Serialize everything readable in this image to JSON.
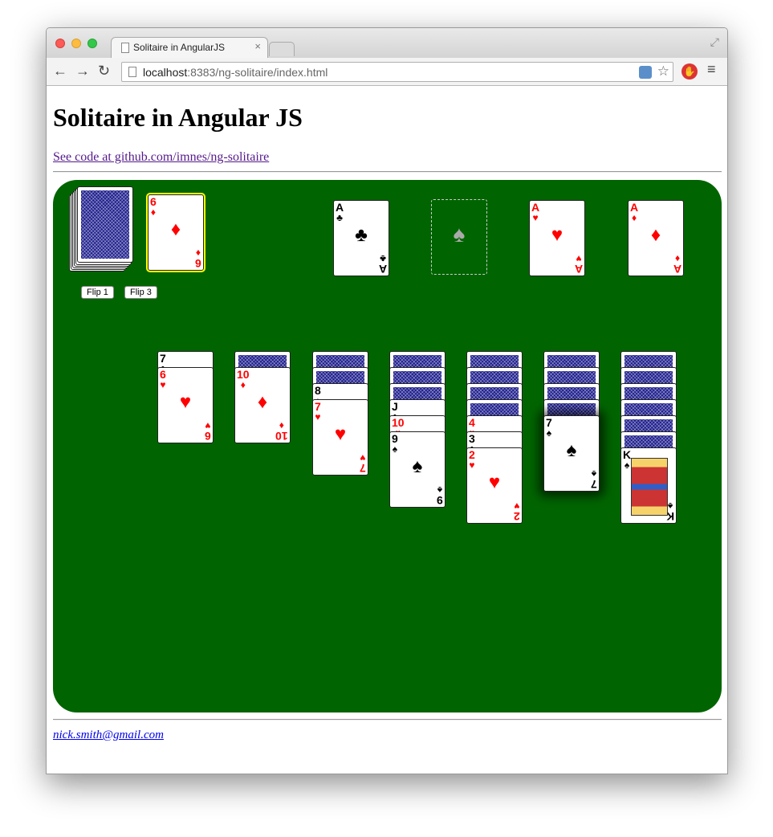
{
  "browser": {
    "tab_title": "Solitaire in AngularJS",
    "tab_close": "×",
    "url_host": "localhost",
    "url_rest": ":8383/ng-solitaire/index.html",
    "back_icon": "←",
    "forward_icon": "→",
    "reload_icon": "↻",
    "star_icon": "☆",
    "menu_icon": "≡"
  },
  "page": {
    "title": "Solitaire in Angular JS",
    "code_link": "See code at github.com/imnes/ng-solitaire",
    "footer_email": "nick.smith@gmail.com"
  },
  "controls": {
    "flip1": "Flip 1",
    "flip3": "Flip 3"
  },
  "game": {
    "waste_card": {
      "rank": "6",
      "suit": "♦",
      "color": "red",
      "selected": true
    },
    "foundations": [
      {
        "rank": "A",
        "suit": "♣",
        "color": "black"
      },
      {
        "empty": true,
        "placeholder_suit": "♠"
      },
      {
        "rank": "A",
        "suit": "♥",
        "color": "red"
      },
      {
        "rank": "A",
        "suit": "♦",
        "color": "red"
      }
    ],
    "tableau": [
      {
        "face_down": 0,
        "face_up": [
          {
            "rank": "7",
            "suit": "♣"
          },
          {
            "rank": "6",
            "suit": "♥"
          }
        ]
      },
      {
        "face_down": 1,
        "face_up": [
          {
            "rank": "10",
            "suit": "♦"
          }
        ]
      },
      {
        "face_down": 2,
        "face_up": [
          {
            "rank": "8",
            "suit": "♠"
          },
          {
            "rank": "7",
            "suit": "♥"
          }
        ]
      },
      {
        "face_down": 3,
        "face_up": [
          {
            "rank": "J",
            "suit": "♣"
          },
          {
            "rank": "10",
            "suit": "♥"
          },
          {
            "rank": "9",
            "suit": "♠"
          }
        ]
      },
      {
        "face_down": 4,
        "face_up": [
          {
            "rank": "4",
            "suit": "♥"
          },
          {
            "rank": "3",
            "suit": "♣"
          },
          {
            "rank": "2",
            "suit": "♥"
          }
        ]
      },
      {
        "face_down": 4,
        "face_up": [
          {
            "rank": "7",
            "suit": "♠",
            "highlighted": true
          }
        ]
      },
      {
        "face_down": 6,
        "face_up": [
          {
            "rank": "K",
            "suit": "♠"
          }
        ]
      }
    ]
  }
}
